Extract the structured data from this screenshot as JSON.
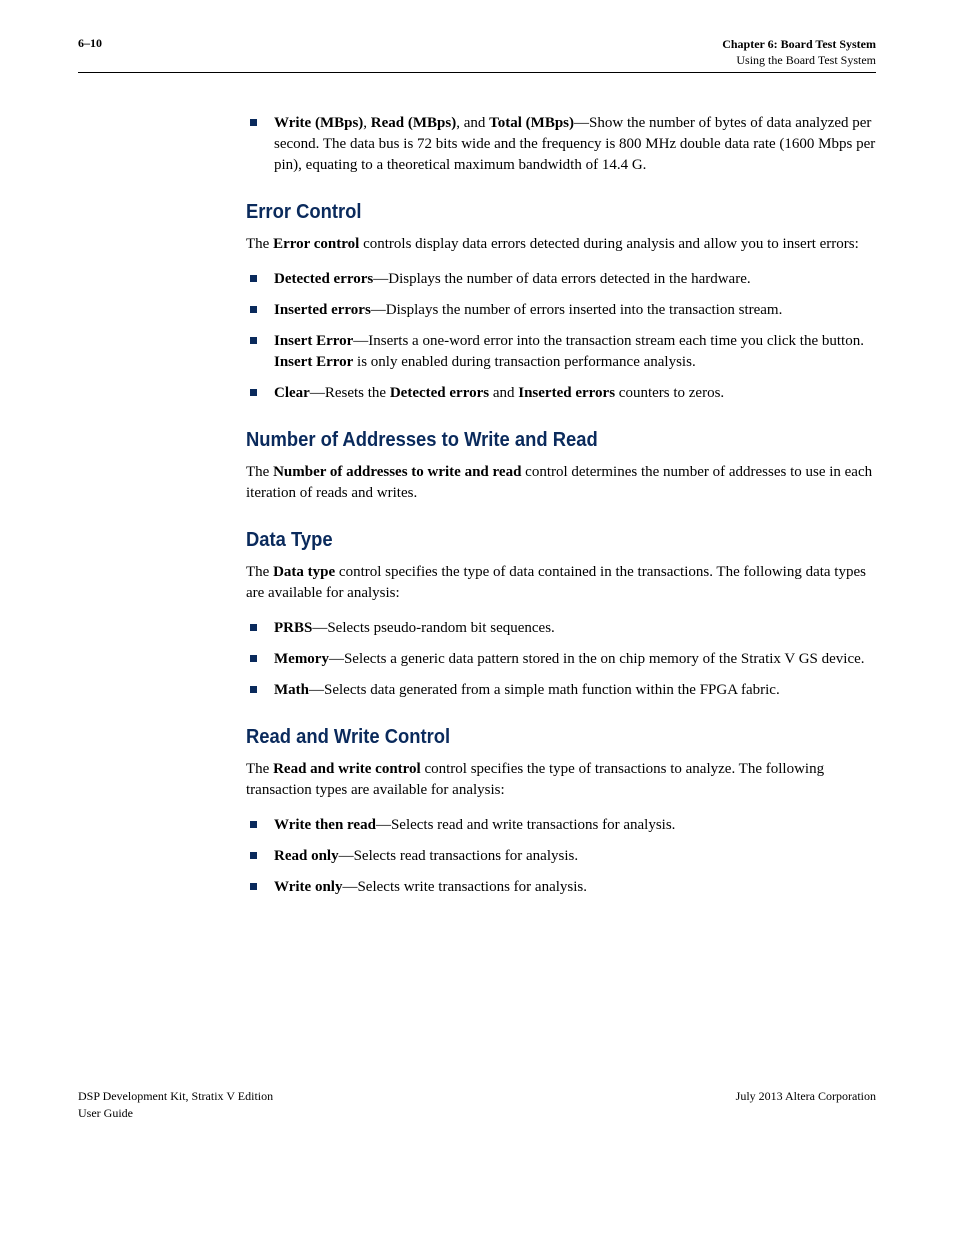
{
  "header": {
    "page_number": "6–10",
    "chapter_line": "Chapter 6:  Board Test System",
    "section_line": "Using the Board Test System"
  },
  "intro_bullet": {
    "b1": "Write (MBps)",
    "b2": "Read (MBps)",
    "sep_and": ", and ",
    "b3": "Total (MBps)",
    "rest": "—Show the number of bytes of data analyzed per second. The data bus is 72 bits wide and the frequency is 800 MHz double data rate (1600 Mbps per pin), equating to a theoretical maximum bandwidth of 14.4 G."
  },
  "error_control": {
    "heading": "Error Control",
    "intro_pre": "The ",
    "intro_bold": "Error control",
    "intro_post": " controls display data errors detected during analysis and allow you to insert errors:",
    "items": {
      "detected": {
        "bold": "Detected errors",
        "rest": "—Displays the number of data errors detected in the hardware."
      },
      "inserted": {
        "bold": "Inserted errors",
        "rest": "—Displays the number of errors inserted into the transaction stream."
      },
      "insert": {
        "bold": "Insert Error",
        "rest_a": "—Inserts a one-word error into the transaction stream each time you click the button. ",
        "bold2": "Insert Error",
        "rest_b": " is only enabled during transaction performance analysis."
      },
      "clear": {
        "bold": "Clear",
        "rest_a": "—Resets the ",
        "bold2": "Detected errors",
        "rest_b": " and ",
        "bold3": "Inserted errors",
        "rest_c": " counters to zeros."
      }
    }
  },
  "addresses": {
    "heading": "Number of Addresses to Write and Read",
    "pre": "The ",
    "bold": "Number of addresses to write and read",
    "post": " control determines the number of addresses to use in each iteration of reads and writes."
  },
  "data_type": {
    "heading": "Data Type",
    "pre": "The ",
    "bold": "Data type",
    "post": " control specifies the type of data contained in the transactions. The following data types are available for analysis:",
    "items": {
      "prbs": {
        "bold": "PRBS",
        "rest": "—Selects pseudo-random bit sequences."
      },
      "memory": {
        "bold": "Memory",
        "rest": "—Selects a generic data pattern stored in the on chip memory of the Stratix V GS device."
      },
      "math": {
        "bold": "Math",
        "rest": "—Selects data generated from a simple math function within the FPGA fabric."
      }
    }
  },
  "rw_control": {
    "heading": "Read and Write Control",
    "pre": "The ",
    "bold": "Read and write control",
    "post": " control specifies the type of transactions to analyze. The following transaction types are available for analysis:",
    "items": {
      "wtr": {
        "bold": "Write then read",
        "rest": "—Selects read and write transactions for analysis."
      },
      "ro": {
        "bold": "Read only",
        "rest": "—Selects read transactions for analysis."
      },
      "wo": {
        "bold": "Write only",
        "rest": "—Selects write transactions for analysis."
      }
    }
  },
  "footer": {
    "left_line1": "DSP Development Kit, Stratix V Edition",
    "left_line2": "User Guide",
    "right": "July 2013   Altera Corporation"
  }
}
